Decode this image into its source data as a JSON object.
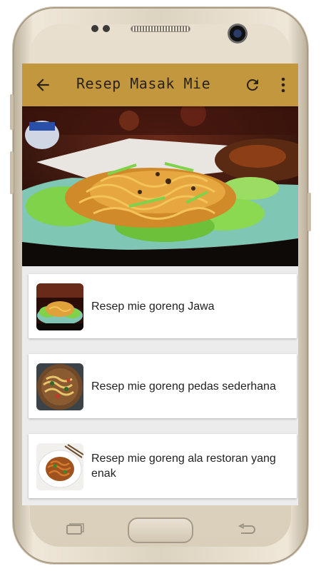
{
  "app": {
    "title": "Resep Masak Mie",
    "accent_color": "#c3973d",
    "icons": {
      "back": "arrow-back-icon",
      "refresh": "refresh-icon",
      "more": "more-vert-icon"
    }
  },
  "hero": {
    "image": "plate-of-fried-noodles-with-lettuce"
  },
  "recipes": [
    {
      "label": "Resep mie goreng Jawa",
      "thumb": "mie-goreng-jawa-photo"
    },
    {
      "label": "Resep mie goreng pedas sederhana",
      "thumb": "mie-goreng-pedas-photo"
    },
    {
      "label": "Resep mie goreng ala restoran yang enak",
      "thumb": "mie-goreng-restoran-photo"
    }
  ]
}
